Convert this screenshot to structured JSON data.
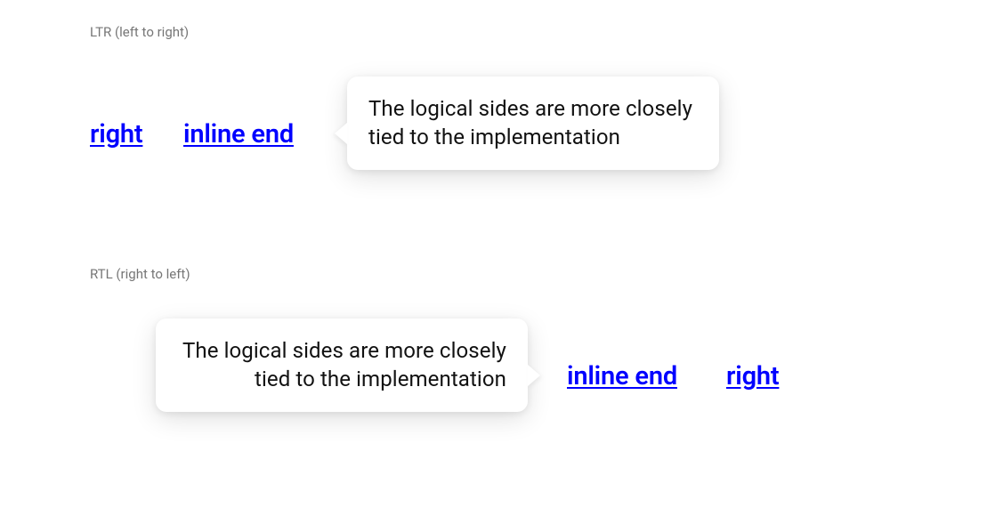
{
  "ltr": {
    "section_label": "LTR (left to right)",
    "link_right": "right",
    "link_inline_end": "inline end",
    "popover_text": "The logical sides are more closely tied to the implementation"
  },
  "rtl": {
    "section_label": "RTL (right to left)",
    "link_right": "right",
    "link_inline_end": "inline end",
    "popover_text": "The logical sides are more closely tied to the implementation"
  }
}
